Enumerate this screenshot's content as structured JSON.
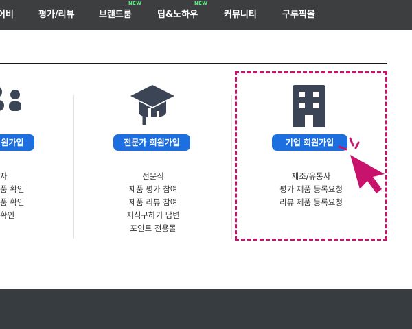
{
  "nav": {
    "items": [
      {
        "label": "어비",
        "badge": ""
      },
      {
        "label": "평가/리뷰",
        "badge": ""
      },
      {
        "label": "브랜드룸",
        "badge": "NEW"
      },
      {
        "label": "팁&노하우",
        "badge": "NEW"
      },
      {
        "label": "커뮤니티",
        "badge": ""
      },
      {
        "label": "구루픽몰",
        "badge": ""
      }
    ]
  },
  "signup": {
    "columns": [
      {
        "button_label": "원가입",
        "icon": "users-icon",
        "features": [
          "자",
          "품 확인",
          "품 확인",
          "확인"
        ]
      },
      {
        "button_label": "전문가 회원가입",
        "icon": "graduation-cap-icon",
        "features": [
          "전문직",
          "제품 평가 참여",
          "제품 리뷰 참여",
          "지식구하기 답변",
          "포인트 전용몰"
        ]
      },
      {
        "button_label": "기업 회원가입",
        "icon": "building-icon",
        "features": [
          "제조/유통사",
          "평가 제품 등록요청",
          "리뷰 제품 등록요청"
        ]
      }
    ]
  },
  "colors": {
    "nav_bg": "#3d3e40",
    "accent": "#1d6fe0",
    "highlight": "#c8126c",
    "icon": "#3c4556",
    "footer": "#363c40"
  }
}
